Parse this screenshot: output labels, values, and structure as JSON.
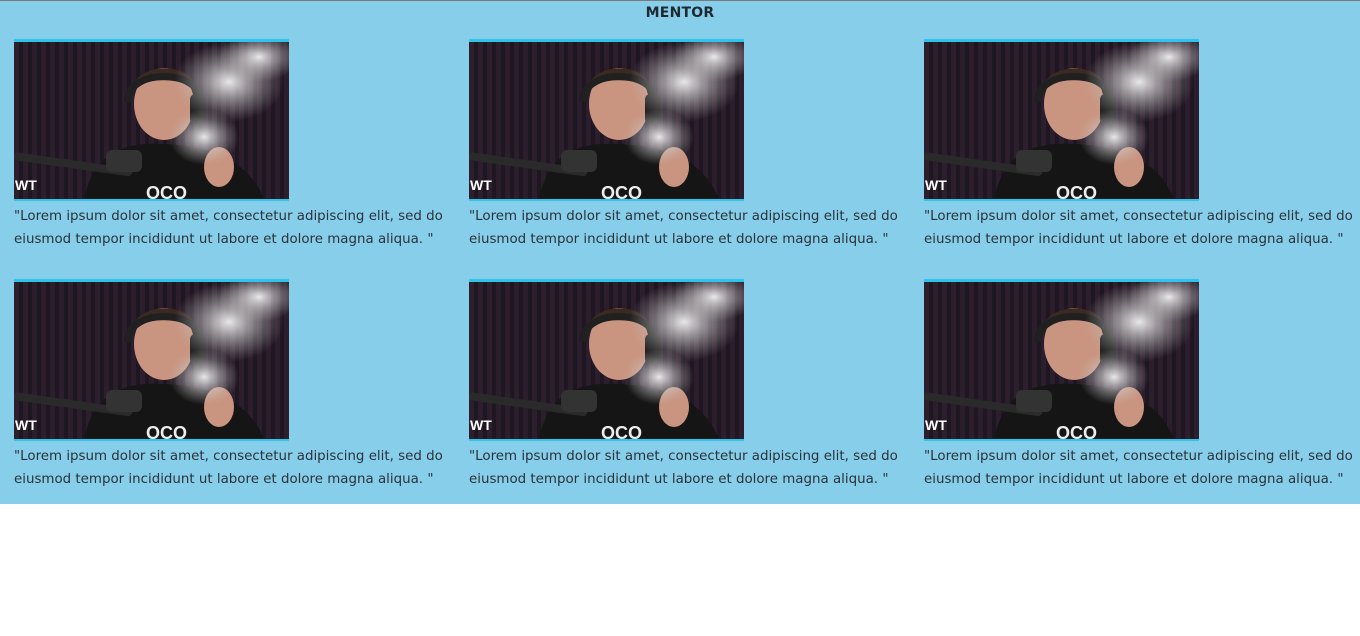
{
  "section": {
    "title": "MENTOR"
  },
  "cards": [
    {
      "caption": "\"Lorem ipsum dolor sit amet, consectetur adipiscing elit, sed do eiusmod tempor incididunt ut labore et dolore magna aliqua. \"",
      "watermark": "WT",
      "shirt_text": "OCO"
    },
    {
      "caption": "\"Lorem ipsum dolor sit amet, consectetur adipiscing elit, sed do eiusmod tempor incididunt ut labore et dolore magna aliqua. \"",
      "watermark": "WT",
      "shirt_text": "OCO"
    },
    {
      "caption": "\"Lorem ipsum dolor sit amet, consectetur adipiscing elit, sed do eiusmod tempor incididunt ut labore et dolore magna aliqua. \"",
      "watermark": "WT",
      "shirt_text": "OCO"
    },
    {
      "caption": "\"Lorem ipsum dolor sit amet, consectetur adipiscing elit, sed do eiusmod tempor incididunt ut labore et dolore magna aliqua. \"",
      "watermark": "WT",
      "shirt_text": "OCO"
    },
    {
      "caption": "\"Lorem ipsum dolor sit amet, consectetur adipiscing elit, sed do eiusmod tempor incididunt ut labore et dolore magna aliqua. \"",
      "watermark": "WT",
      "shirt_text": "OCO"
    },
    {
      "caption": "\"Lorem ipsum dolor sit amet, consectetur adipiscing elit, sed do eiusmod tempor incididunt ut labore et dolore magna aliqua. \"",
      "watermark": "WT",
      "shirt_text": "OCO"
    }
  ],
  "colors": {
    "section_background": "#87ceeb",
    "image_border": "#2fc4ea",
    "caption_text": "#2b3238"
  }
}
